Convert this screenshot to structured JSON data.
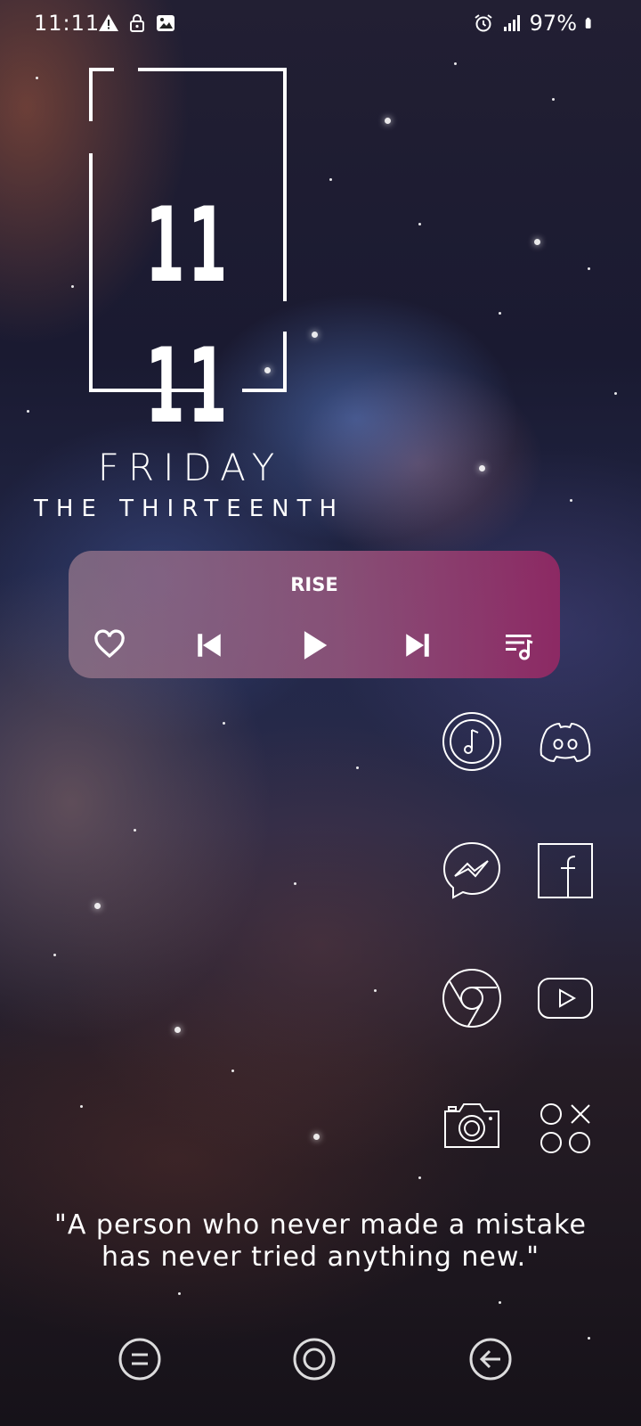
{
  "status_bar": {
    "time": "11:11",
    "battery": "97%",
    "left_icons": [
      "warning-icon",
      "lock-icon",
      "image-icon"
    ],
    "right_icons": [
      "alarm-icon",
      "signal-icon",
      "battery-icon"
    ]
  },
  "clock_widget": {
    "hour": "11",
    "minute": "11"
  },
  "date_widget": {
    "day": "FRIDAY",
    "subtitle": "THE THIRTEENTH"
  },
  "music_widget": {
    "song_title": "RISE",
    "controls": [
      "heart-icon",
      "previous-icon",
      "play-icon",
      "next-icon",
      "playlist-icon"
    ],
    "gradient_start": "#967882",
    "gradient_end": "#962864"
  },
  "apps": [
    {
      "name": "music-app-icon"
    },
    {
      "name": "discord-icon"
    },
    {
      "name": "messenger-icon"
    },
    {
      "name": "facebook-icon"
    },
    {
      "name": "chrome-icon"
    },
    {
      "name": "youtube-icon"
    },
    {
      "name": "camera-icon"
    },
    {
      "name": "games-icon"
    }
  ],
  "quote": {
    "line1": "\"A person who never made a mistake",
    "line2": "has never tried anything new.\""
  },
  "nav_bar": {
    "buttons": [
      "recents-icon",
      "home-icon",
      "back-icon"
    ]
  }
}
